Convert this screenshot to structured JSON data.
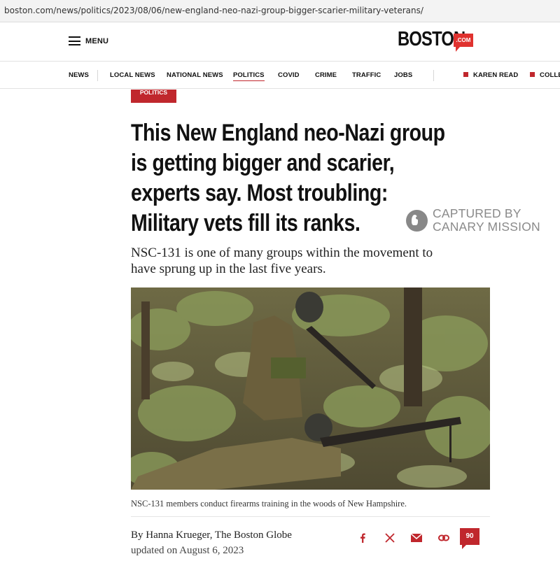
{
  "browser": {
    "url": "boston.com/news/politics/2023/08/06/new-england-neo-nazi-group-bigger-scarier-military-veterans/"
  },
  "header": {
    "menu_label": "MENU",
    "logo": {
      "word": "BOSTON",
      "suffix": ".COM"
    }
  },
  "nav": {
    "items": [
      "NEWS",
      "LOCAL NEWS",
      "NATIONAL NEWS",
      "POLITICS",
      "COVID",
      "CRIME",
      "TRAFFIC",
      "JOBS"
    ],
    "active": "POLITICS",
    "featured": [
      "KAREN READ",
      "COLLEGE"
    ]
  },
  "article": {
    "section": "POLITICS",
    "headline_lines": [
      "This New England neo-Nazi group",
      "is getting bigger and scarier,",
      "experts say. Most troubling:",
      "Military vets fill its ranks."
    ],
    "dek_lines": [
      "NSC-131 is one of many groups within the movement to",
      "have sprung up in the last five years."
    ],
    "caption": "NSC-131 members conduct firearms training in the woods of New Hampshire.",
    "byline": "By Hanna Krueger, The Boston Globe",
    "updated": "updated on August 6, 2023",
    "comment_count": "90"
  },
  "watermark": {
    "line1": "CAPTURED BY",
    "line2": "CANARY MISSION"
  },
  "share_icons": [
    "facebook-icon",
    "x-icon",
    "email-icon",
    "link-icon"
  ],
  "colors": {
    "brand_red": "#c0272d",
    "logo_red": "#e0322f"
  }
}
